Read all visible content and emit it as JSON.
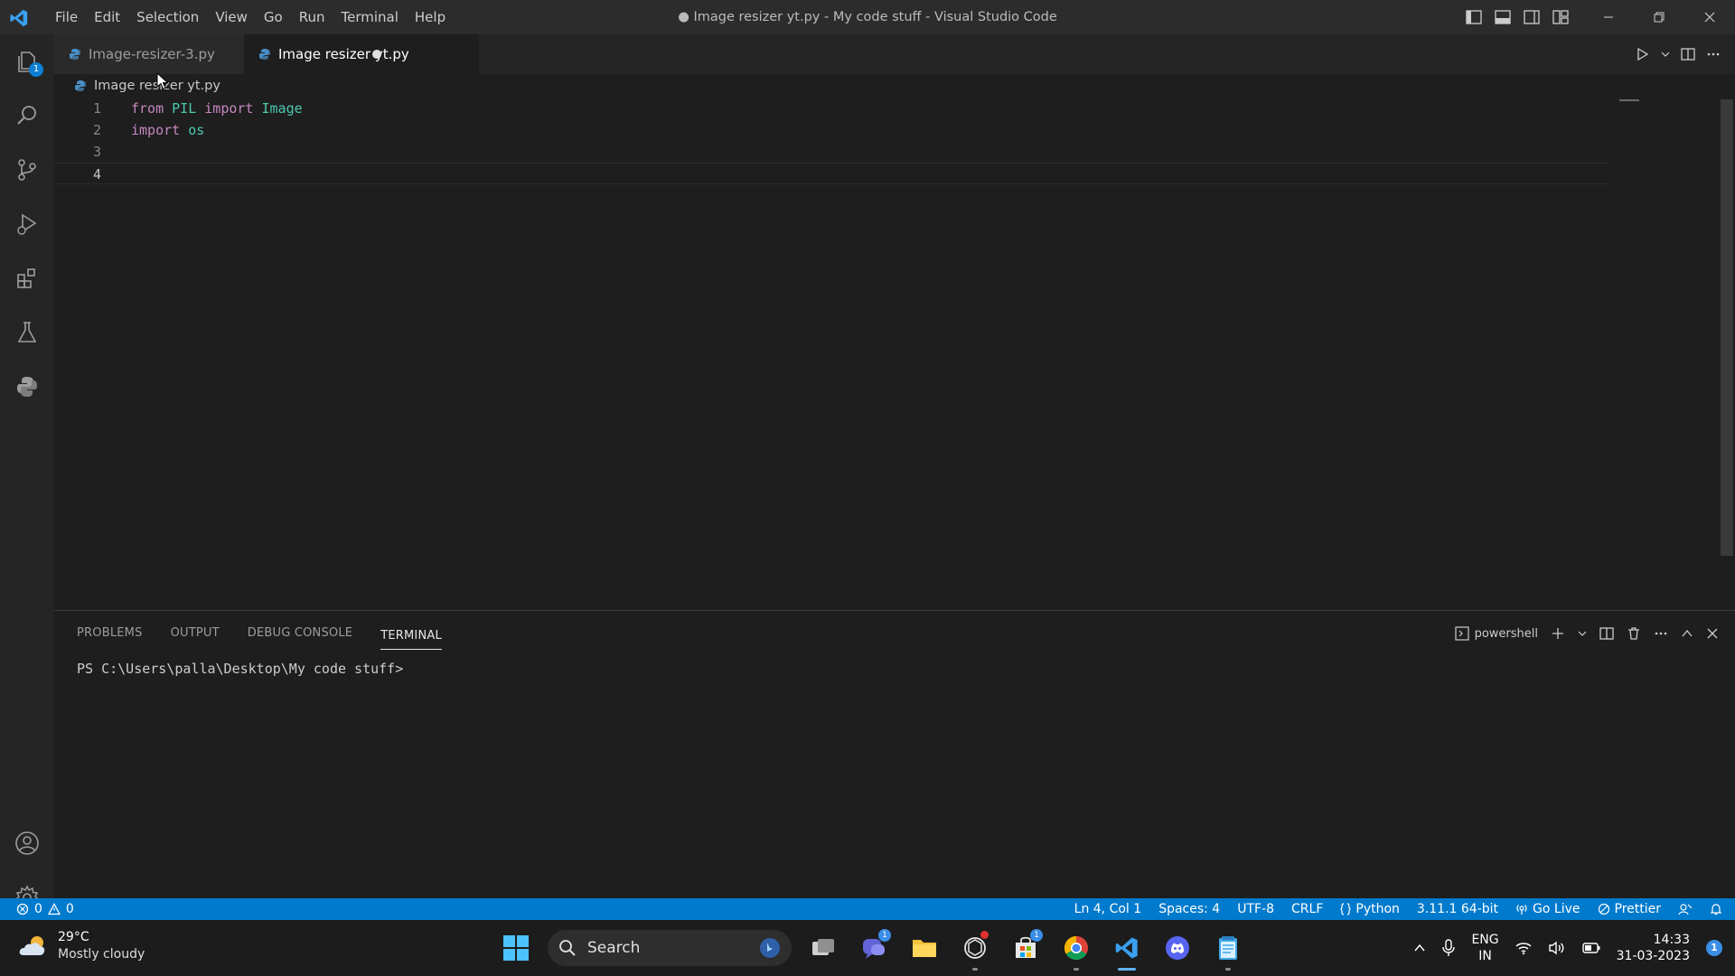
{
  "window": {
    "title": "● Image resizer yt.py - My code stuff - Visual Studio Code"
  },
  "menu": [
    "File",
    "Edit",
    "Selection",
    "View",
    "Go",
    "Run",
    "Terminal",
    "Help"
  ],
  "activity_bar": {
    "explorer_badge": "1",
    "items": [
      "files-icon",
      "search-icon",
      "source-control-icon",
      "run-debug-icon",
      "extensions-icon",
      "testing-icon",
      "python-icon"
    ],
    "bottom": [
      "account-icon",
      "settings-gear-icon"
    ]
  },
  "tabs": [
    {
      "label": "Image-resizer-3.py",
      "active": false
    },
    {
      "label": "Image resizer yt.py",
      "active": true,
      "modified": true
    }
  ],
  "breadcrumb": "Image resizer yt.py",
  "editor": {
    "lines": [
      {
        "number": "1",
        "tokens": [
          {
            "t": "from",
            "c": "kw"
          },
          {
            "t": " "
          },
          {
            "t": "PIL",
            "c": "mod"
          },
          {
            "t": " "
          },
          {
            "t": "import",
            "c": "kw"
          },
          {
            "t": " "
          },
          {
            "t": "Image",
            "c": "mod"
          }
        ]
      },
      {
        "number": "2",
        "tokens": [
          {
            "t": "import",
            "c": "kw"
          },
          {
            "t": " "
          },
          {
            "t": "os",
            "c": "mod"
          }
        ]
      },
      {
        "number": "3",
        "tokens": []
      },
      {
        "number": "4",
        "tokens": [],
        "current": true
      }
    ]
  },
  "panel": {
    "tabs": [
      "PROBLEMS",
      "OUTPUT",
      "DEBUG CONSOLE",
      "TERMINAL"
    ],
    "active_tab": "TERMINAL",
    "terminal_profile": "powershell",
    "terminal_text": "PS C:\\Users\\palla\\Desktop\\My code stuff>"
  },
  "status_bar": {
    "errors": "0",
    "warnings": "0",
    "position": "Ln 4, Col 1",
    "spaces": "Spaces: 4",
    "encoding": "UTF-8",
    "eol": "CRLF",
    "language": "Python",
    "interpreter": "3.11.1 64-bit",
    "go_live": "Go Live",
    "prettier": "Prettier"
  },
  "taskbar": {
    "weather_temp": "29°C",
    "weather_desc": "Mostly cloudy",
    "search_label": "Search",
    "teams_badge": "1",
    "store_badge": "1",
    "lang_top": "ENG",
    "lang_bottom": "IN",
    "time": "14:33",
    "date": "31-03-2023",
    "notification_badge": "1"
  },
  "colors": {
    "accent": "#007acc",
    "keyword": "#c586c0",
    "module": "#4ec9b0",
    "background": "#1e1e1e"
  }
}
